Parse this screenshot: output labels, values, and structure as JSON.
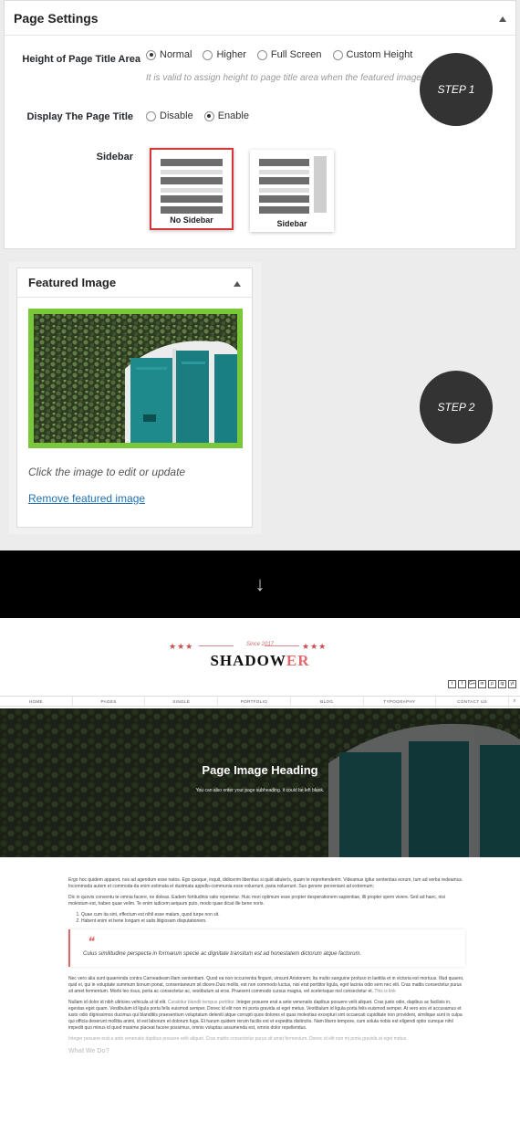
{
  "page_settings": {
    "title": "Page Settings",
    "height_row": {
      "label": "Height of Page Title Area",
      "options": [
        {
          "label": "Normal",
          "selected": true
        },
        {
          "label": "Higher",
          "selected": false
        },
        {
          "label": "Full Screen",
          "selected": false
        },
        {
          "label": "Custom Height",
          "selected": false
        }
      ],
      "hint": "It is valid to assign height to page title area when the featured image is not empty."
    },
    "display_row": {
      "label": "Display The Page Title",
      "options": [
        {
          "label": "Disable",
          "selected": false
        },
        {
          "label": "Enable",
          "selected": true
        }
      ]
    },
    "sidebar_row": {
      "label": "Sidebar",
      "options": [
        {
          "label": "No Sidebar",
          "selected": true
        },
        {
          "label": "Sidebar",
          "selected": false
        }
      ]
    }
  },
  "steps": {
    "step1": "STEP 1",
    "step2": "STEP 2"
  },
  "featured_image": {
    "title": "Featured Image",
    "caption": "Click the image to edit or update",
    "remove_link": "Remove featured image"
  },
  "arrow": "↓",
  "site": {
    "since": "Since 2017",
    "brand_main": "SHADOW",
    "brand_accent": "ER",
    "social": [
      "t",
      "f",
      "G+",
      "in",
      "p",
      "ig",
      "yt"
    ],
    "nav": [
      "HOME",
      "PAGES",
      "SINGLE",
      "PORTFOLIO",
      "BLOG",
      "TYPOGRAPHY",
      "CONTACT US"
    ],
    "hero_title": "Page Image Heading",
    "hero_subtitle": "You can also enter your page subheading. It could be left blank.",
    "para1": "Ergo hoc quidem apparet, nos ad agendum esse natos. Ego quoque, inquit, didicerim libentius si quid attulerís, quam te reprehenderim. Videamus igitur sententias eorum, tum ad verba redeamus. Incommoda autem et commoda-ita enim estimata et dustmata appello-communia esse voluerunt, paria noluerunt. Suo genere perveniant ad extremum;",
    "para2": "Dic in quovis conventu te omnia facere, ne doleas. Eadem fortitudinis ratio reperietur. Huic mori optimum esse propter desperationem sapientiae, illi propter spem vivere. Sed ad haec, nisi molestum est, habeo quae velim. Te enim iudicem aequum puto, modo quae dicat ille bene noris.",
    "list": [
      "Quae cum ita sint, effectum est nihil esse malum, quod turpe non sit.",
      "Habent enim et bene longam et satis litigiosam disputationem."
    ],
    "quote": "Cuius similitudine perspecta in formarum specie ac dignitate transitum est ad honestatem dictorum atque factorum.",
    "para3": "Nec vero alia sunt quaerenda contra Carneadeam illam sententiam. Quod ea non occurrentia fingunt, vincunt Aristonem; Ita multo sanguine profuso in laetitia et in victoria est mortuus. Illud quaero, quid ei, qui in voluptate summum bonum ponat, consentaneum sit dicere.Duis mollis, est non commodo luctus, nisi erat porttitor ligula, eget lacinia odio sem nec elit. Cras mattis consectetur purus sit amet fermentum. Morbi leo risus, porta ac consectetur ac, vestibulum at eros. Praesent commodo cursus magna, vel scelerisque nisl consectetur et.",
    "para3_link": "This is link",
    "para4_a": "Nullam id dolor id nibh ultricies vehicula ut id elit.",
    "para4_link": "Curabitur blandit tempus porttitor.",
    "para4_b": "Integer posuere erat a ante venenatis dapibus posuere velit aliquet. Cras justo odio, dapibus ac facilisis in, egestas eget quam. Vestibulum id ligula porta felis euismod semper. Donec id elit non mi porta gravida at eget metus. Vestibulum id ligula porta felis euismod semper. At vero eos et accusamus et iusto odio dignissimos ducimus qui blanditiis praesentium voluptatum deleniti atque corrupti quos dolores et quas molestias excepturi sint occaecati cupiditate non provident, similique sunt in culpa qui officia deserunt mollitia animi, id est laborum et dolorum fuga. Et harum quidem rerum facilis est et expedita distinctio. Nam libero tempore, cum soluta nobis est eligendi optio cumque nihil impedit quo minus id quod maxime placeat facere possimus, omnis voluptas assumenda est, omnis dolor repellendus.",
    "para5": "Integer posuere erat a ante venenatis dapibus posuere velit aliquet. Cras mattis consectetur purus sit amet fermentum. Donec id elit non mi porta gravida at eget metus.",
    "heading_what": "What We Do?"
  },
  "colors": {
    "selected_border": "#d63638",
    "featured_frame": "#79c83a",
    "accent": "#e06a6a",
    "link": "#2271b1"
  }
}
